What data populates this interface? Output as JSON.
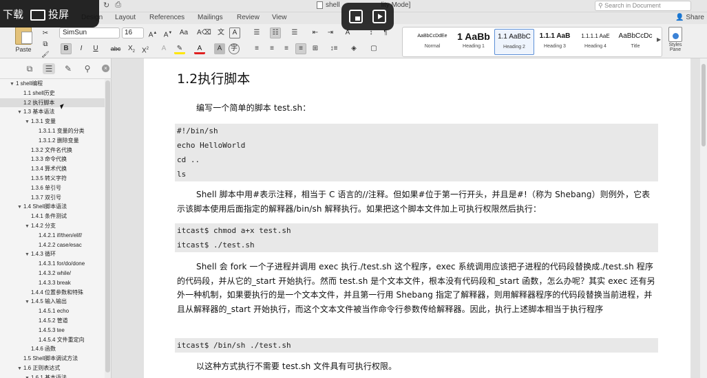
{
  "window": {
    "doc_title": "shell",
    "doc_title_suffix": "lity Mode]",
    "search_placeholder": "Search in Document",
    "share_label": "Share"
  },
  "tabs": [
    "Design",
    "Layout",
    "References",
    "Mailings",
    "Review",
    "View"
  ],
  "overlay": {
    "download_label": "下载",
    "cast_label": "投屏"
  },
  "ribbon": {
    "paste_label": "Paste",
    "font_name": "SimSun",
    "font_size": "16",
    "styles_pane_label": "Styles Pane",
    "styles": [
      {
        "sample": "AaBbCcDdEe",
        "name": "Normal"
      },
      {
        "sample": "1 AaBb",
        "name": "Heading 1"
      },
      {
        "sample": "1.1 AaBbC",
        "name": "Heading 2"
      },
      {
        "sample": "1.1.1 AaB",
        "name": "Heading 3"
      },
      {
        "sample": "1.1.1.1 AaE",
        "name": "Heading 4"
      },
      {
        "sample": "AaBbCcDc",
        "name": "Title"
      }
    ],
    "selected_style": "Heading 2"
  },
  "nav": {
    "items": [
      {
        "level": 0,
        "tri": "▼",
        "label": "1 shell编程"
      },
      {
        "level": 1,
        "tri": "",
        "label": "1.1 shell历史"
      },
      {
        "level": 1,
        "tri": "",
        "label": "1.2 执行脚本",
        "selected": true
      },
      {
        "level": 1,
        "tri": "▼",
        "label": "1.3 基本语法"
      },
      {
        "level": 2,
        "tri": "▼",
        "label": "1.3.1 变量"
      },
      {
        "level": 3,
        "tri": "",
        "label": "1.3.1.1 变量的分类"
      },
      {
        "level": 3,
        "tri": "",
        "label": "1.3.1.2 删除变量"
      },
      {
        "level": 2,
        "tri": "",
        "label": "1.3.2 文件名代换"
      },
      {
        "level": 2,
        "tri": "",
        "label": "1.3.3 命令代换"
      },
      {
        "level": 2,
        "tri": "",
        "label": "1.3.4 算术代换"
      },
      {
        "level": 2,
        "tri": "",
        "label": "1.3.5 转义字符"
      },
      {
        "level": 2,
        "tri": "",
        "label": "1.3.6 单引号"
      },
      {
        "level": 2,
        "tri": "",
        "label": "1.3.7 双引号"
      },
      {
        "level": 1,
        "tri": "▼",
        "label": "1.4 Shell脚本语法"
      },
      {
        "level": 2,
        "tri": "",
        "label": "1.4.1 条件测试"
      },
      {
        "level": 2,
        "tri": "▼",
        "label": "1.4.2 分支"
      },
      {
        "level": 3,
        "tri": "",
        "label": "1.4.2.1 if/then/elif/"
      },
      {
        "level": 3,
        "tri": "",
        "label": "1.4.2.2 case/esac"
      },
      {
        "level": 2,
        "tri": "▼",
        "label": "1.4.3 循环"
      },
      {
        "level": 3,
        "tri": "",
        "label": "1.4.3.1 for/do/done"
      },
      {
        "level": 3,
        "tri": "",
        "label": "1.4.3.2 while/"
      },
      {
        "level": 3,
        "tri": "",
        "label": "1.4.3.3 break"
      },
      {
        "level": 2,
        "tri": "",
        "label": "1.4.4 位置参数和特殊"
      },
      {
        "level": 2,
        "tri": "▼",
        "label": "1.4.5 输入输出"
      },
      {
        "level": 3,
        "tri": "",
        "label": "1.4.5.1 echo"
      },
      {
        "level": 3,
        "tri": "",
        "label": "1.4.5.2 管道"
      },
      {
        "level": 3,
        "tri": "",
        "label": "1.4.5.3 tee"
      },
      {
        "level": 3,
        "tri": "",
        "label": "1.4.5.4 文件重定向"
      },
      {
        "level": 2,
        "tri": "",
        "label": "1.4.6 函数"
      },
      {
        "level": 1,
        "tri": "",
        "label": "1.5 Shell脚本调试方法"
      },
      {
        "level": 1,
        "tri": "▼",
        "label": "1.6 正则表达式"
      },
      {
        "level": 2,
        "tri": "▼",
        "label": "1.6.1 基本语法"
      }
    ]
  },
  "document": {
    "heading": "1.2执行脚本",
    "para1": "编写一个简单的脚本 test.sh：",
    "code1": [
      "#!/bin/sh",
      "echo HelloWorld",
      "cd ..",
      "ls"
    ],
    "para2": "Shell 脚本中用#表示注释，相当于 C 语言的//注释。但如果#位于第一行开头，并且是#!（称为 Shebang）则例外，它表示该脚本使用后面指定的解释器/bin/sh 解释执行。如果把这个脚本文件加上可执行权限然后执行：",
    "code2": [
      "itcast$ chmod a+x test.sh",
      "itcast$ ./test.sh"
    ],
    "para3": "Shell 会 fork 一个子进程并调用 exec 执行./test.sh 这个程序，exec 系统调用应该把子进程的代码段替换成./test.sh 程序的代码段，并从它的_start 开始执行。然而 test.sh 是个文本文件，根本没有代码段和_start 函数，怎么办呢？其实 exec 还有另外一种机制，如果要执行的是一个文本文件，并且第一行用 Shebang 指定了解释器，则用解释器程序的代码段替换当前进程，并且从解释器的_start 开始执行，而这个文本文件被当作命令行参数传给解释器。因此，执行上述脚本相当于执行程序",
    "code3": [
      "itcast$ /bin/sh ./test.sh"
    ],
    "para4": "以这种方式执行不需要 test.sh 文件具有可执行权限。"
  }
}
